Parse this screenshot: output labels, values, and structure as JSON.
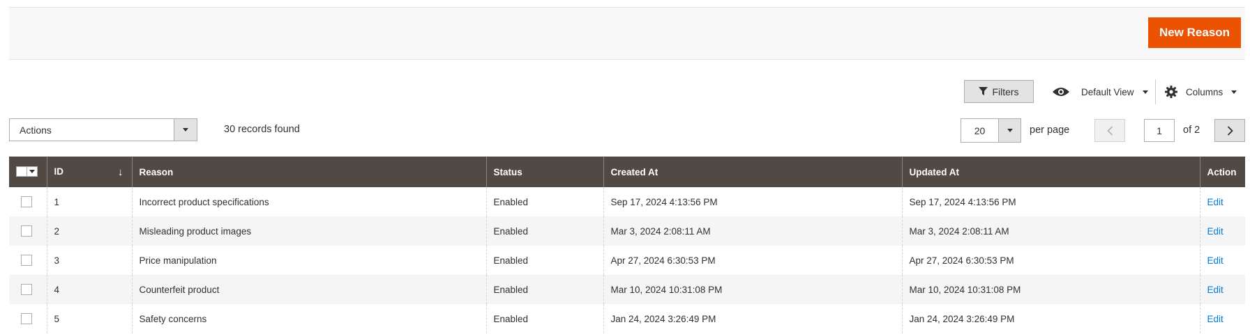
{
  "page_actions": {
    "new_button": "New Reason"
  },
  "toolbar": {
    "filters_label": "Filters",
    "view_label": "Default View",
    "columns_label": "Columns"
  },
  "mass_actions": {
    "label": "Actions"
  },
  "records_found": "30 records found",
  "pager": {
    "per_page_value": "20",
    "per_page_label": "per page",
    "current_page": "1",
    "of_label": "of 2"
  },
  "table": {
    "columns": [
      "ID",
      "Reason",
      "Status",
      "Created At",
      "Updated At",
      "Action"
    ],
    "rows": [
      {
        "id": "1",
        "reason": "Incorrect product specifications",
        "status": "Enabled",
        "created": "Sep 17, 2024 4:13:56 PM",
        "updated": "Sep 17, 2024 4:13:56 PM",
        "action": "Edit"
      },
      {
        "id": "2",
        "reason": "Misleading product images",
        "status": "Enabled",
        "created": "Mar 3, 2024 2:08:11 AM",
        "updated": "Mar 3, 2024 2:08:11 AM",
        "action": "Edit"
      },
      {
        "id": "3",
        "reason": "Price manipulation",
        "status": "Enabled",
        "created": "Apr 27, 2024 6:30:53 PM",
        "updated": "Apr 27, 2024 6:30:53 PM",
        "action": "Edit"
      },
      {
        "id": "4",
        "reason": "Counterfeit product",
        "status": "Enabled",
        "created": "Mar 10, 2024 10:31:08 PM",
        "updated": "Mar 10, 2024 10:31:08 PM",
        "action": "Edit"
      },
      {
        "id": "5",
        "reason": "Safety concerns",
        "status": "Enabled",
        "created": "Jan 24, 2024 3:26:49 PM",
        "updated": "Jan 24, 2024 3:26:49 PM",
        "action": "Edit"
      }
    ]
  },
  "colors": {
    "accent": "#eb5202",
    "header_bg": "#514943",
    "link": "#007bdb"
  }
}
